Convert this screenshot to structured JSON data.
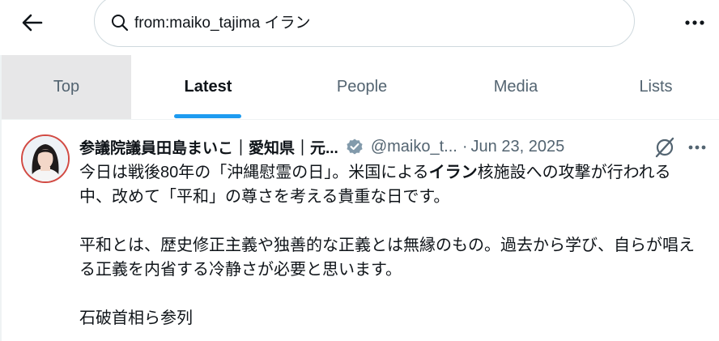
{
  "search": {
    "query": "from:maiko_tajima イラン"
  },
  "tabs": [
    {
      "label": "Top"
    },
    {
      "label": "Latest"
    },
    {
      "label": "People"
    },
    {
      "label": "Media"
    },
    {
      "label": "Lists"
    }
  ],
  "tweet": {
    "display_name": "参議院議員田島まいこ｜愛知県｜元...",
    "handle": "@maiko_t...",
    "separator": "·",
    "date": "Jun 23, 2025",
    "line1_pre": "今日は戦後80年の「沖縄慰霊の日」。米国による",
    "line1_highlight": "イラン",
    "line1_post": "核施設への攻撃が行われる中、改めて「平和」の尊さを考える貴重な日です。",
    "paragraph2": "平和とは、歴史修正主義や独善的な正義とは無縁のもの。過去から学び、自らが唱える正義を内省する冷静さが必要と思います。",
    "paragraph3": "石破首相ら参列"
  },
  "colors": {
    "accent": "#1d9bf0",
    "text_primary": "#0f1419",
    "text_secondary": "#536471",
    "hover_tab_bg": "#e7e7e8",
    "border": "#cfd9de"
  },
  "icons": [
    "back-arrow-icon",
    "search-icon",
    "more-options-icon",
    "verified-badge-icon",
    "grok-icon",
    "tweet-more-icon"
  ]
}
